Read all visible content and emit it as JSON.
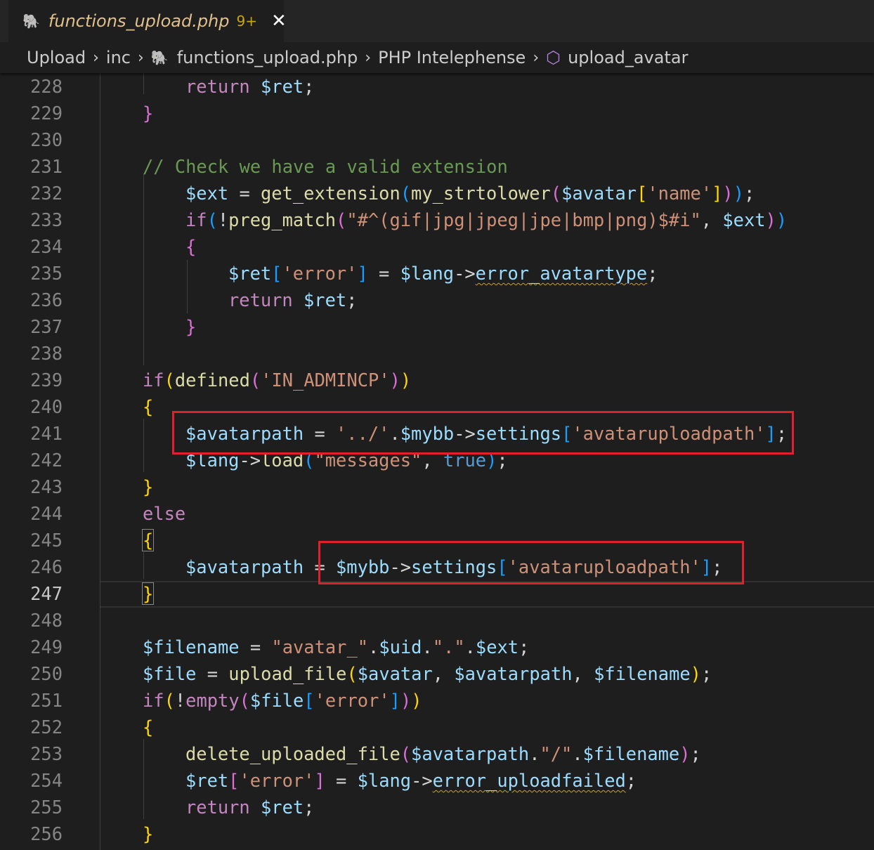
{
  "tab": {
    "title": "functions_upload.php",
    "badge": "9+",
    "close": "✕",
    "icon": "php-elephant-icon"
  },
  "breadcrumb": {
    "items": [
      "Upload",
      "inc",
      "functions_upload.php",
      "PHP Intelephense",
      "upload_avatar"
    ]
  },
  "editor": {
    "current_line": 247,
    "line_numbers": [
      "228",
      "229",
      "230",
      "231",
      "232",
      "233",
      "234",
      "235",
      "236",
      "237",
      "238",
      "239",
      "240",
      "241",
      "242",
      "243",
      "244",
      "245",
      "246",
      "247",
      "248",
      "249",
      "250",
      "251",
      "252",
      "253",
      "254",
      "255",
      "256"
    ],
    "lines": {
      "l228": "return $ret;",
      "l229": "}",
      "l231": "// Check we have a valid extension",
      "l232": "$ext = get_extension(my_strtolower($avatar['name']));",
      "l233": "if(!preg_match(\"#^(gif|jpg|jpeg|jpe|bmp|png)$#i\", $ext))",
      "l234": "{",
      "l235": "$ret['error'] = $lang->error_avatartype;",
      "l236": "return $ret;",
      "l237": "}",
      "l239": "if(defined('IN_ADMINCP'))",
      "l240": "{",
      "l241": "$avatarpath = '../'.$mybb->settings['avataruploadpath'];",
      "l242": "$lang->load(\"messages\", true);",
      "l243": "}",
      "l244": "else",
      "l245": "{",
      "l246": "$avatarpath = $mybb->settings['avataruploadpath'];",
      "l247": "}",
      "l249": "$filename = \"avatar_\".$uid.\".\".$ext;",
      "l250": "$file = upload_file($avatar, $avatarpath, $filename);",
      "l251": "if(!empty($file['error']))",
      "l252": "{",
      "l253": "delete_uploaded_file($avatarpath.\"/\".$filename);",
      "l254": "$ret['error'] = $lang->error_uploadfailed;",
      "l255": "return $ret;",
      "l256": "}"
    }
  },
  "colors": {
    "highlight_box": "#e0202e",
    "background": "#1e1e1e",
    "keyword": "#c586c0",
    "variable": "#9cdcfe",
    "function": "#dcdcaa",
    "string": "#ce9178",
    "comment": "#6a9955"
  }
}
